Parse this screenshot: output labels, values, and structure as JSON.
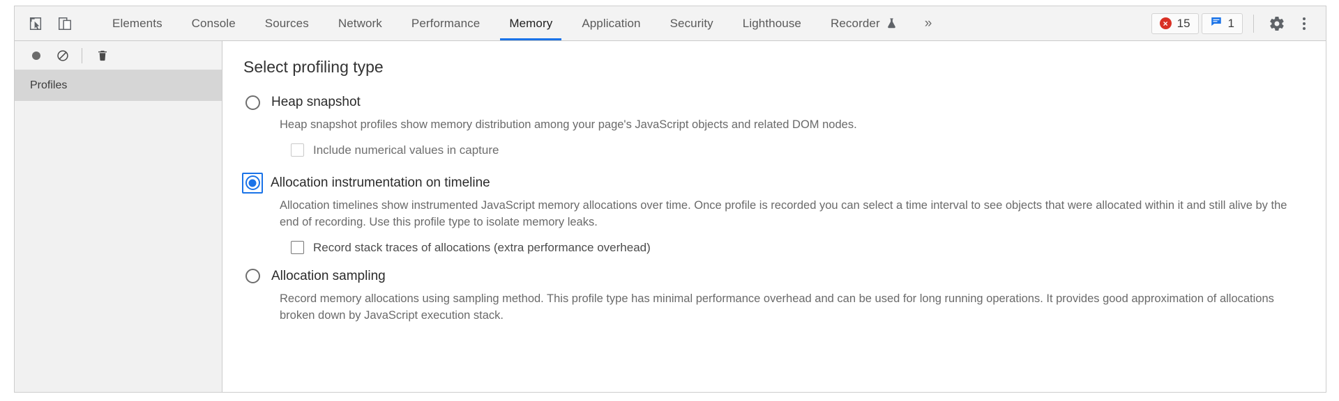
{
  "toolbar": {
    "inspect_icon": "inspect-cursor-icon",
    "device_icon": "device-toolbar-icon",
    "tabs": [
      {
        "label": "Elements",
        "active": false
      },
      {
        "label": "Console",
        "active": false
      },
      {
        "label": "Sources",
        "active": false
      },
      {
        "label": "Network",
        "active": false
      },
      {
        "label": "Performance",
        "active": false
      },
      {
        "label": "Memory",
        "active": true
      },
      {
        "label": "Application",
        "active": false
      },
      {
        "label": "Security",
        "active": false
      },
      {
        "label": "Lighthouse",
        "active": false
      },
      {
        "label": "Recorder",
        "active": false,
        "experiment_icon": "flask-icon"
      }
    ],
    "more_tabs": "»",
    "errors": {
      "icon": "error-circle-icon",
      "glyph": "×",
      "count": "15",
      "color": "#d93025"
    },
    "messages": {
      "icon": "message-bubble-icon",
      "count": "1",
      "color": "#1a73e8"
    },
    "settings_icon": "gear-icon",
    "more_options_icon": "kebab-menu-icon"
  },
  "sidebar": {
    "record_icon": "record-circle-icon",
    "clear_icon": "clear-prohibited-icon",
    "delete_icon": "trash-icon",
    "section_title": "Profiles"
  },
  "main": {
    "title": "Select profiling type",
    "options": [
      {
        "label": "Heap snapshot",
        "selected": false,
        "focused": false,
        "description": "Heap snapshot profiles show memory distribution among your page's JavaScript objects and related DOM nodes.",
        "sub_option": {
          "label": "Include numerical values in capture",
          "checked": false,
          "muted": true
        }
      },
      {
        "label": "Allocation instrumentation on timeline",
        "selected": true,
        "focused": true,
        "description": "Allocation timelines show instrumented JavaScript memory allocations over time. Once profile is recorded you can select a time interval to see objects that were allocated within it and still alive by the end of recording. Use this profile type to isolate memory leaks.",
        "sub_option": {
          "label": "Record stack traces of allocations (extra performance overhead)",
          "checked": false,
          "muted": false
        }
      },
      {
        "label": "Allocation sampling",
        "selected": false,
        "focused": false,
        "description": "Record memory allocations using sampling method. This profile type has minimal performance overhead and can be used for long running operations. It provides good approximation of allocations broken down by JavaScript execution stack.",
        "sub_option": null
      }
    ]
  },
  "colors": {
    "accent": "#1a73e8",
    "error": "#d93025",
    "toolbar_bg": "#f3f3f3",
    "selected_row_bg": "#d6d6d6"
  }
}
